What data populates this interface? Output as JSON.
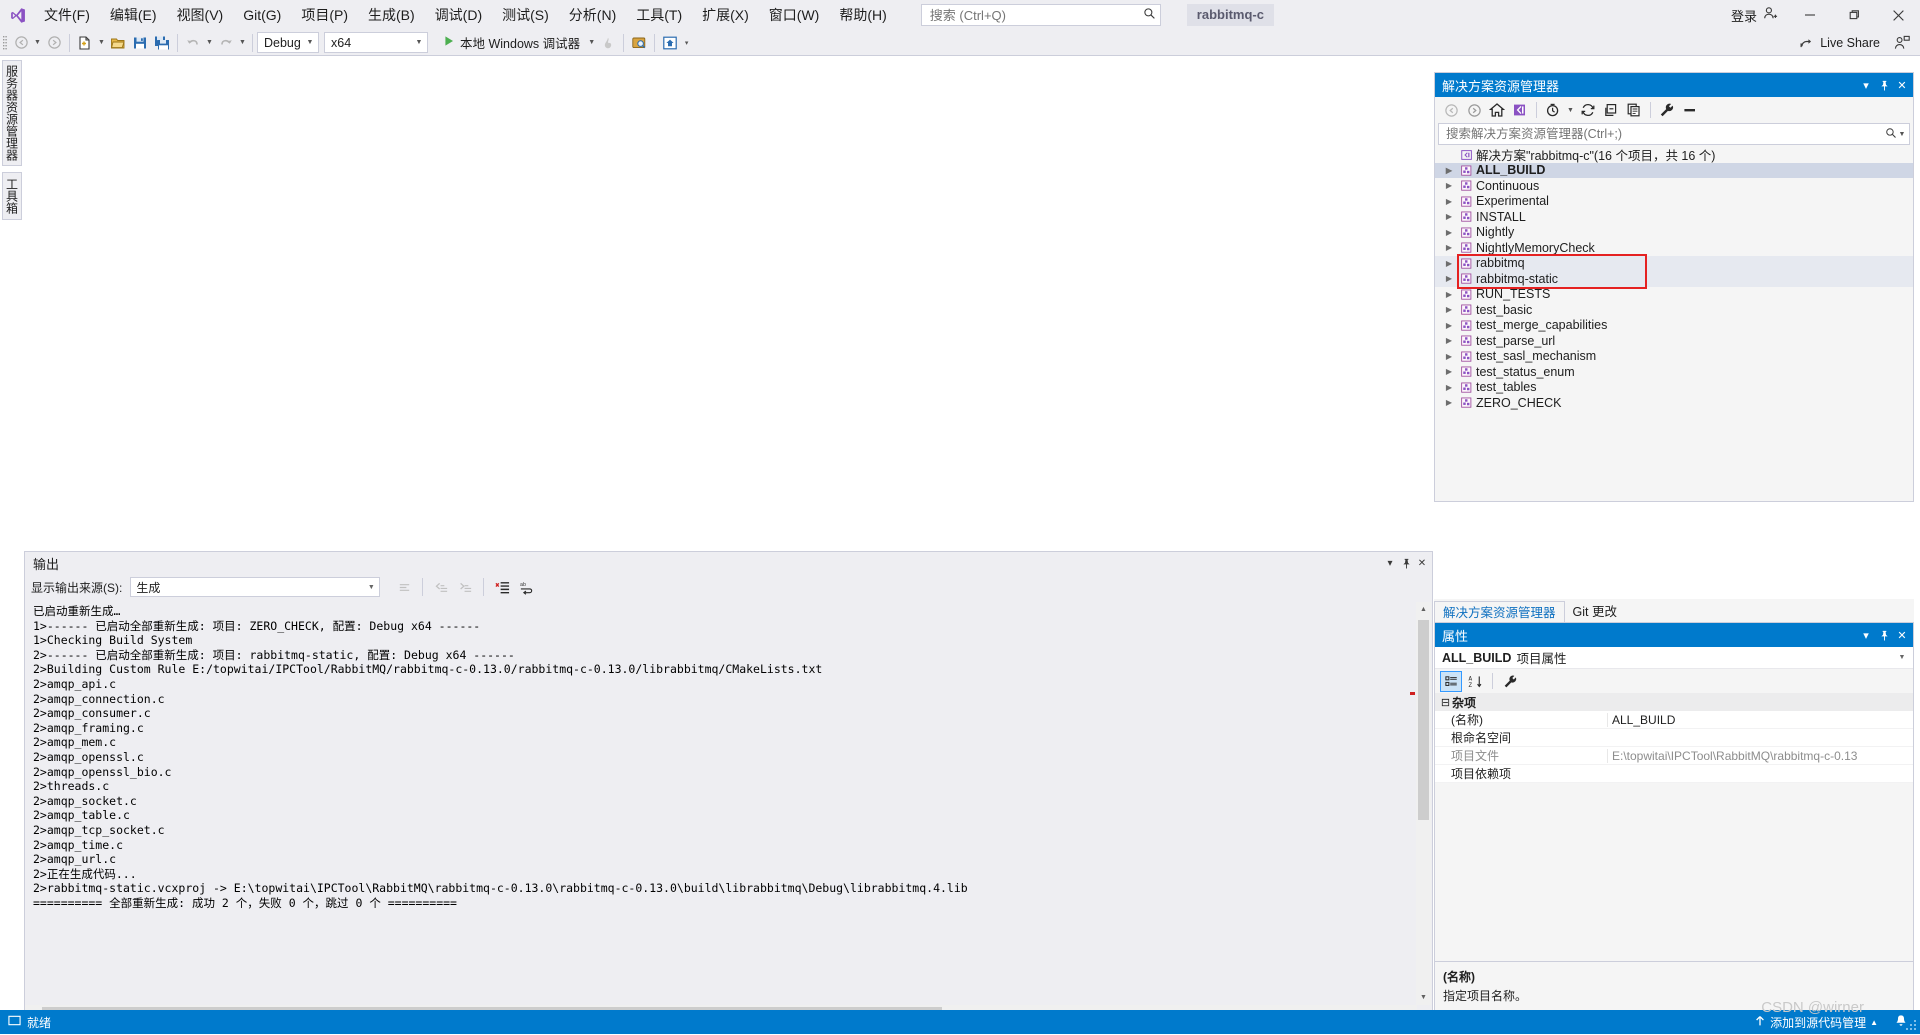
{
  "titlebar": {
    "logo_icon": "visual-studio-logo",
    "menus": [
      {
        "label": "文件(F)"
      },
      {
        "label": "编辑(E)"
      },
      {
        "label": "视图(V)"
      },
      {
        "label": "Git(G)"
      },
      {
        "label": "项目(P)"
      },
      {
        "label": "生成(B)"
      },
      {
        "label": "调试(D)"
      },
      {
        "label": "测试(S)"
      },
      {
        "label": "分析(N)"
      },
      {
        "label": "工具(T)"
      },
      {
        "label": "扩展(X)"
      },
      {
        "label": "窗口(W)"
      },
      {
        "label": "帮助(H)"
      }
    ],
    "search": {
      "placeholder": "搜索 (Ctrl+Q)",
      "value": "",
      "icon": "search-icon"
    },
    "project_chip": "rabbitmq-c",
    "signin_label": "登录",
    "minimize": "—",
    "maximize": "❐",
    "close": "✕"
  },
  "toolbar": {
    "nav_back": "◀",
    "nav_forward": "▶",
    "new_item_tip": "新建项",
    "open_tip": "打开",
    "save_tip": "保存",
    "save_all_tip": "全部保存",
    "undo_tip": "撤消",
    "redo_tip": "恢复",
    "config_value": "Debug",
    "platform_value": "x64",
    "run_label": "本地 Windows 调试器",
    "live_share_label": "Live Share"
  },
  "left_tabs": [
    {
      "label": "服务器资源管理器"
    },
    {
      "label": "工具箱"
    }
  ],
  "output_panel": {
    "title": "输出",
    "source_label": "显示输出来源(S):",
    "source_value": "生成",
    "buttons": {
      "clear": "clear-output-icon",
      "toggle_wrap": "word-wrap-icon",
      "goto_prev": "prev-message-icon",
      "goto_next": "next-message-icon",
      "find": "find-message-icon"
    },
    "header_buttons": {
      "dropdown": "▾",
      "pin": "📌",
      "close": "✕"
    },
    "lines": [
      "已启动重新生成…",
      "1>------ 已启动全部重新生成: 项目: ZERO_CHECK, 配置: Debug x64 ------",
      "1>Checking Build System",
      "2>------ 已启动全部重新生成: 项目: rabbitmq-static, 配置: Debug x64 ------",
      "2>Building Custom Rule E:/topwitai/IPCTool/RabbitMQ/rabbitmq-c-0.13.0/rabbitmq-c-0.13.0/librabbitmq/CMakeLists.txt",
      "2>amqp_api.c",
      "2>amqp_connection.c",
      "2>amqp_consumer.c",
      "2>amqp_framing.c",
      "2>amqp_mem.c",
      "2>amqp_openssl.c",
      "2>amqp_openssl_bio.c",
      "2>threads.c",
      "2>amqp_socket.c",
      "2>amqp_table.c",
      "2>amqp_tcp_socket.c",
      "2>amqp_time.c",
      "2>amqp_url.c",
      "2>正在生成代码...",
      "2>rabbitmq-static.vcxproj -> E:\\topwitai\\IPCTool\\RabbitMQ\\rabbitmq-c-0.13.0\\rabbitmq-c-0.13.0\\build\\librabbitmq\\Debug\\librabbitmq.4.lib",
      "========== 全部重新生成: 成功 2 个，失败 0 个，跳过 0 个 =========="
    ]
  },
  "solution_explorer": {
    "title": "解决方案资源管理器",
    "toolbar_icons": [
      "back-icon",
      "forward-icon",
      "home-icon",
      "solution-view-icon",
      "pending-changes-icon",
      "refresh-icon",
      "collapse-all-icon",
      "show-all-files-icon",
      "properties-icon",
      "preview-selected-icon"
    ],
    "search": {
      "placeholder": "搜索解决方案资源管理器(Ctrl+;)",
      "value": "",
      "icon": "search-icon"
    },
    "solution_node": "解决方案\"rabbitmq-c\"(16 个项目，共 16 个)",
    "tree_items": [
      {
        "label": "ALL_BUILD",
        "state": "selected"
      },
      {
        "label": "Continuous",
        "state": "normal"
      },
      {
        "label": "Experimental",
        "state": "normal"
      },
      {
        "label": "INSTALL",
        "state": "normal"
      },
      {
        "label": "Nightly",
        "state": "normal"
      },
      {
        "label": "NightlyMemoryCheck",
        "state": "normal"
      },
      {
        "label": "rabbitmq",
        "state": "highlighted"
      },
      {
        "label": "rabbitmq-static",
        "state": "highlighted"
      },
      {
        "label": "RUN_TESTS",
        "state": "normal"
      },
      {
        "label": "test_basic",
        "state": "normal"
      },
      {
        "label": "test_merge_capabilities",
        "state": "normal"
      },
      {
        "label": "test_parse_url",
        "state": "normal"
      },
      {
        "label": "test_sasl_mechanism",
        "state": "normal"
      },
      {
        "label": "test_status_enum",
        "state": "normal"
      },
      {
        "label": "test_tables",
        "state": "normal"
      },
      {
        "label": "ZERO_CHECK",
        "state": "normal"
      }
    ],
    "annotation_color": "#e52121"
  },
  "dock_tabs": [
    {
      "label": "解决方案资源管理器",
      "active": true
    },
    {
      "label": "Git 更改",
      "active": false
    }
  ],
  "properties_panel": {
    "title": "属性",
    "object_name": "ALL_BUILD",
    "object_suffix": "项目属性",
    "toolbar_icons": [
      "categorized-icon",
      "alphabetical-icon",
      "property-pages-icon"
    ],
    "category": "杂项",
    "rows": [
      {
        "name": "(名称)",
        "value": "ALL_BUILD",
        "dim": false
      },
      {
        "name": "根命名空间",
        "value": "",
        "dim": false
      },
      {
        "name": "项目文件",
        "value": "E:\\topwitai\\IPCTool\\RabbitMQ\\rabbitmq-c-0.13",
        "dim": true
      },
      {
        "name": "项目依赖项",
        "value": "",
        "dim": false
      }
    ],
    "help_title": "(名称)",
    "help_text": "指定项目名称。"
  },
  "statusbar": {
    "ready_text": "就绪",
    "ready_icon": "status-ready-icon",
    "source_control_label": "添加到源代码管理",
    "source_control_icon": "up-arrow-icon",
    "notification_icon": "bell-icon",
    "chevron_icon": "▲",
    "accent_color": "#007acc"
  },
  "watermark": "CSDN @wirner"
}
